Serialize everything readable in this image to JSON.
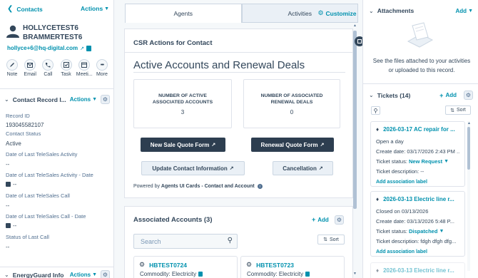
{
  "left": {
    "back_label": "Contacts",
    "actions_label": "Actions",
    "name_line1": "HOLLYCETEST6",
    "name_line2": "BRAMMERTEST6",
    "email": "hollyce+6@hq-digital.com",
    "quick_actions": [
      {
        "label": "Note",
        "icon": "note-icon"
      },
      {
        "label": "Email",
        "icon": "email-icon"
      },
      {
        "label": "Call",
        "icon": "phone-icon"
      },
      {
        "label": "Task",
        "icon": "task-icon"
      },
      {
        "label": "Meeti...",
        "icon": "meeting-icon"
      },
      {
        "label": "More",
        "icon": "more-icon"
      }
    ],
    "section_title": "Contact Record I...",
    "section_actions": "Actions",
    "fields": [
      {
        "label": "Record ID",
        "value": "193045582107"
      },
      {
        "label": "Contact Status",
        "value": "Active"
      },
      {
        "label": "Date of Last TeleSales Activity",
        "value": "--"
      },
      {
        "label": "Date of Last TeleSales Activity - Date",
        "value": "--"
      },
      {
        "label": "Date of Last TeleSales Call",
        "value": "--"
      },
      {
        "label": "Date of Last TeleSales Call - Date",
        "value": "--"
      },
      {
        "label": "Status of Last Call",
        "value": "--"
      }
    ],
    "bottom_section_title": "EnergyGuard Info",
    "bottom_section_actions": "Actions"
  },
  "tabs": {
    "agents": "Agents",
    "activities": "Activities",
    "customize": "Customize"
  },
  "csr": {
    "title": "CSR Actions for Contact",
    "heading": "Active Accounts and Renewal Deals",
    "stat1_label": "NUMBER OF ACTIVE ASSOCIATED ACCOUNTS",
    "stat1_value": "3",
    "stat2_label": "NUMBER OF ASSOCIATED RENEWAL DEALS",
    "stat2_value": "0",
    "btn_new_sale": "New Sale Quote Form",
    "btn_renewal": "Renewal Quote Form",
    "btn_update": "Update Contact Information",
    "btn_cancel": "Cancellation",
    "powered_prefix": "Powered by",
    "powered_link": "Agents UI Cards - Contact and Account"
  },
  "accounts": {
    "title": "Associated Accounts (3)",
    "add_label": "Add",
    "search_placeholder": "Search",
    "sort_label": "Sort",
    "items": [
      {
        "name": "HBTEST0724",
        "commodity_label": "Commodity:",
        "commodity": "Electricity"
      },
      {
        "name": "HBTEST0723",
        "commodity_label": "Commodity:",
        "commodity": "Electricity"
      }
    ]
  },
  "attachments": {
    "title": "Attachments",
    "add_label": "Add",
    "empty_text": "See the files attached to your activities or uploaded to this record."
  },
  "tickets": {
    "title": "Tickets (14)",
    "add_label": "Add",
    "sort_label": "Sort",
    "items": [
      {
        "title": "2026-03-17 AC repair for ...",
        "line1": "Open a day",
        "create_label": "Create date:",
        "create_value": "03/17/2026 2:43 PM ...",
        "status_label": "Ticket status:",
        "status_value": "New Request",
        "desc_label": "Ticket description:",
        "desc_value": "--",
        "assoc": "Add association label"
      },
      {
        "title": "2026-03-13 Electric line r...",
        "line1": "Closed on 03/13/2026",
        "create_label": "Create date:",
        "create_value": "03/13/2026 5:48 P...",
        "status_label": "Ticket status:",
        "status_value": "Dispatched",
        "desc_label": "Ticket description:",
        "desc_value": "fdgh dfgh dfg...",
        "assoc": "Add association label"
      },
      {
        "title": "2026-03-13 Electric line r..."
      }
    ]
  }
}
